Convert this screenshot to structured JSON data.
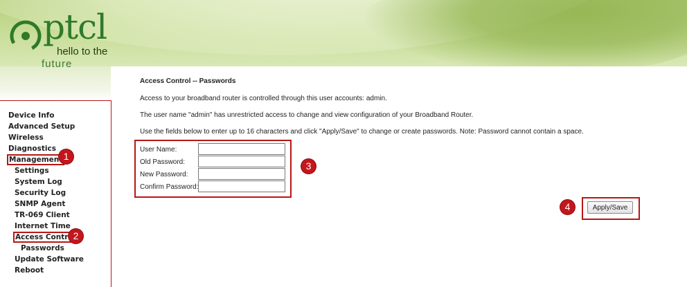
{
  "brand": {
    "logo_text": "ptcl",
    "tagline_line1": "hello to the",
    "tagline_line2": "future",
    "colors": {
      "brand_green": "#2f7a2a",
      "annotation_red": "#c4161c"
    }
  },
  "sidebar": {
    "items": [
      {
        "label": "Device Info",
        "level": 0
      },
      {
        "label": "Advanced Setup",
        "level": 0
      },
      {
        "label": "Wireless",
        "level": 0
      },
      {
        "label": "Diagnostics",
        "level": 0
      },
      {
        "label": "Management",
        "level": 0
      },
      {
        "label": "Settings",
        "level": 1
      },
      {
        "label": "System Log",
        "level": 1
      },
      {
        "label": "Security Log",
        "level": 1
      },
      {
        "label": "SNMP Agent",
        "level": 1
      },
      {
        "label": "TR-069 Client",
        "level": 1
      },
      {
        "label": "Internet Time",
        "level": 1
      },
      {
        "label": "Access Control",
        "level": 1
      },
      {
        "label": "Passwords",
        "level": 2
      },
      {
        "label": "Update Software",
        "level": 1
      },
      {
        "label": "Reboot",
        "level": 1
      }
    ]
  },
  "main": {
    "title": "Access Control -- Passwords",
    "paragraphs": [
      "Access to your broadband router is controlled through this user accounts: admin.",
      "The user name \"admin\" has unrestricted access to change and view configuration of your Broadband Router.",
      "Use the fields below to enter up to 16 characters and click \"Apply/Save\" to change or create passwords. Note: Password cannot contain a space."
    ],
    "form": {
      "fields": [
        {
          "label": "User Name:",
          "value": ""
        },
        {
          "label": "Old Password:",
          "value": ""
        },
        {
          "label": "New Password:",
          "value": ""
        },
        {
          "label": "Confirm Password:",
          "value": ""
        }
      ]
    },
    "apply_button": "Apply/Save"
  },
  "annotations": [
    "1",
    "2",
    "3",
    "4"
  ]
}
